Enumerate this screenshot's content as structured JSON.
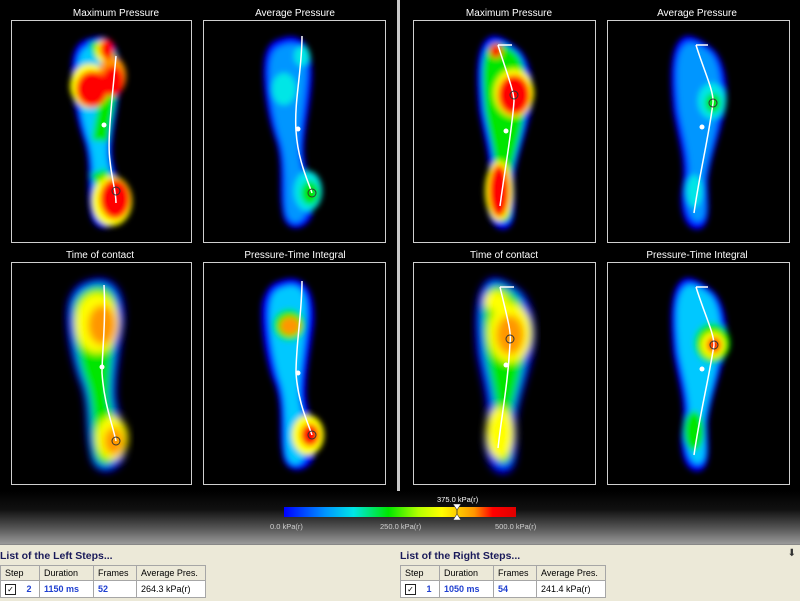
{
  "panels": [
    {
      "id": "left-max",
      "title": "Maximum Pressure"
    },
    {
      "id": "left-avg",
      "title": "Average Pressure"
    },
    {
      "id": "left-toc",
      "title": "Time of contact"
    },
    {
      "id": "left-pti",
      "title": "Pressure-Time Integral"
    },
    {
      "id": "right-max",
      "title": "Maximum Pressure"
    },
    {
      "id": "right-avg",
      "title": "Average Pressure"
    },
    {
      "id": "right-toc",
      "title": "Time of contact"
    },
    {
      "id": "right-pti",
      "title": "Pressure-Time Integral"
    }
  ],
  "scale": {
    "min_label": "0.0 kPa(r)",
    "mid_label": "250.0 kPa(r)",
    "max_label": "500.0 kPa(r)",
    "marker_label": "375.0 kPa(r)",
    "marker_value_kpa": 375,
    "colors": {
      "low": "#0000ff",
      "mid": "#00e600",
      "high": "#ff0000"
    }
  },
  "left_steps": {
    "header": "List of the Left Steps...",
    "columns": [
      "Step",
      "Duration",
      "Frames",
      "Average Pres."
    ],
    "rows": [
      {
        "checked": true,
        "step": "2",
        "duration": "1150 ms",
        "frames": "52",
        "avg": "264.3 kPa(r)"
      }
    ]
  },
  "right_steps": {
    "header": "List of the Right Steps...",
    "columns": [
      "Step",
      "Duration",
      "Frames",
      "Average Pres."
    ],
    "rows": [
      {
        "checked": true,
        "step": "1",
        "duration": "1050 ms",
        "frames": "54",
        "avg": "241.4 kPa(r)"
      }
    ]
  },
  "icons": {
    "collapse": "double-chevron-down-icon",
    "checkbox": "checkbox-checked-icon"
  }
}
